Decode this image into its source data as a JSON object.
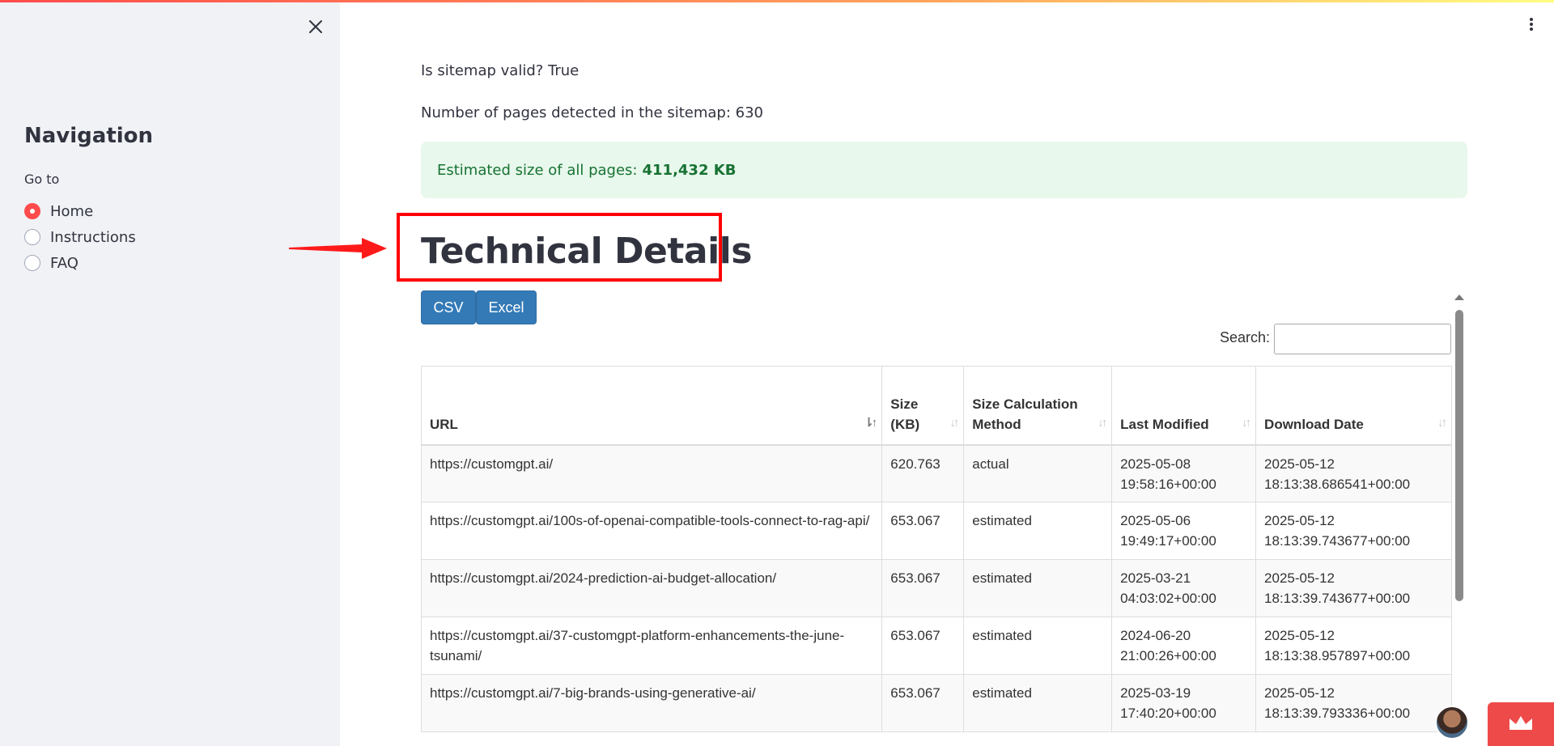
{
  "sidebar": {
    "title": "Navigation",
    "goto_label": "Go to",
    "options": [
      {
        "label": "Home",
        "checked": true
      },
      {
        "label": "Instructions",
        "checked": false
      },
      {
        "label": "FAQ",
        "checked": false
      }
    ]
  },
  "main": {
    "sitemap_valid": "Is sitemap valid? True",
    "pages_detected": "Number of pages detected in the sitemap: 630",
    "estimate_label": "Estimated size of all pages:",
    "estimate_value": "411,432 KB",
    "heading": "Technical Details"
  },
  "toolbar": {
    "csv_label": "CSV",
    "excel_label": "Excel",
    "search_label": "Search:"
  },
  "table": {
    "headers": [
      "URL",
      "Size (KB)",
      "Size Calculation Method",
      "Last Modified",
      "Download Date"
    ],
    "rows": [
      [
        "https://customgpt.ai/",
        "620.763",
        "actual",
        "2025-05-08 19:58:16+00:00",
        "2025-05-12 18:13:38.686541+00:00"
      ],
      [
        "https://customgpt.ai/100s-of-openai-compatible-tools-connect-to-rag-api/",
        "653.067",
        "estimated",
        "2025-05-06 19:49:17+00:00",
        "2025-05-12 18:13:39.743677+00:00"
      ],
      [
        "https://customgpt.ai/2024-prediction-ai-budget-allocation/",
        "653.067",
        "estimated",
        "2025-03-21 04:03:02+00:00",
        "2025-05-12 18:13:39.743677+00:00"
      ],
      [
        "https://customgpt.ai/37-customgpt-platform-enhancements-the-june-tsunami/",
        "653.067",
        "estimated",
        "2024-06-20 21:00:26+00:00",
        "2025-05-12 18:13:38.957897+00:00"
      ],
      [
        "https://customgpt.ai/7-big-brands-using-generative-ai/",
        "653.067",
        "estimated",
        "2025-03-19 17:40:20+00:00",
        "2025-05-12 18:13:39.793336+00:00"
      ]
    ]
  },
  "colors": {
    "accent": "#ff4b4b",
    "success_bg": "#e8f8ec",
    "success_text": "#177233",
    "button_blue": "#337ab7",
    "annotation_red": "#ff0000"
  }
}
